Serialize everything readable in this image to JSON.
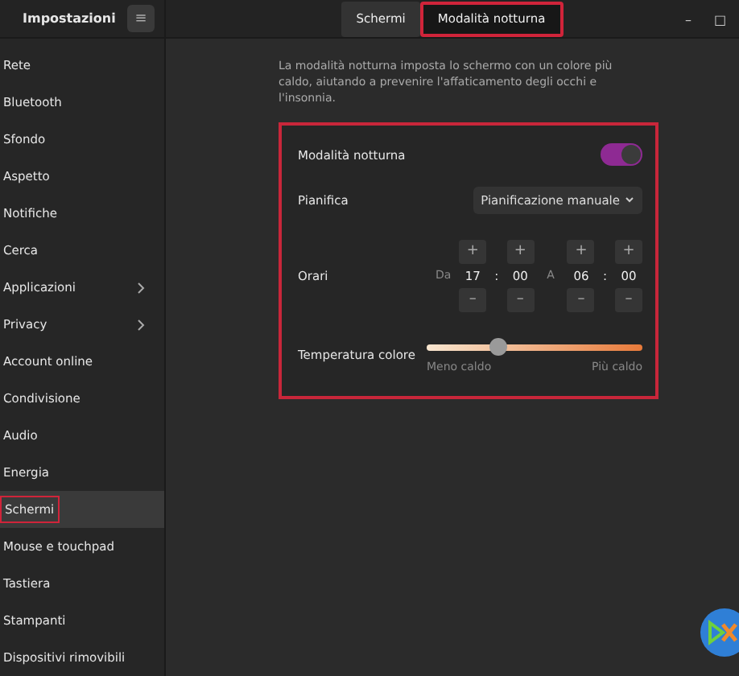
{
  "window": {
    "title": "Impostazioni",
    "menu_button": "≡",
    "controls": [
      "–",
      "□"
    ]
  },
  "tabs": [
    {
      "label": "Schermi",
      "selected": false
    },
    {
      "label": "Modalità notturna",
      "selected": true
    }
  ],
  "sidebar": {
    "items": [
      {
        "label": "Rete",
        "selected": false,
        "has_submenu": false
      },
      {
        "label": "Bluetooth",
        "selected": false,
        "has_submenu": false
      },
      {
        "label": "Sfondo",
        "selected": false,
        "has_submenu": false
      },
      {
        "label": "Aspetto",
        "selected": false,
        "has_submenu": false
      },
      {
        "label": "Notifiche",
        "selected": false,
        "has_submenu": false
      },
      {
        "label": "Cerca",
        "selected": false,
        "has_submenu": false
      },
      {
        "label": "Applicazioni",
        "selected": false,
        "has_submenu": true
      },
      {
        "label": "Privacy",
        "selected": false,
        "has_submenu": true
      },
      {
        "label": "Account online",
        "selected": false,
        "has_submenu": false
      },
      {
        "label": "Condivisione",
        "selected": false,
        "has_submenu": false
      },
      {
        "label": "Audio",
        "selected": false,
        "has_submenu": false
      },
      {
        "label": "Energia",
        "selected": false,
        "has_submenu": false
      },
      {
        "label": "Schermi",
        "selected": true,
        "has_submenu": false
      },
      {
        "label": "Mouse e touchpad",
        "selected": false,
        "has_submenu": false
      },
      {
        "label": "Tastiera",
        "selected": false,
        "has_submenu": false
      },
      {
        "label": "Stampanti",
        "selected": false,
        "has_submenu": false
      },
      {
        "label": "Dispositivi rimovibili",
        "selected": false,
        "has_submenu": false
      }
    ]
  },
  "description": "La modalità notturna imposta lo schermo con un colore più caldo, aiutando a prevenire l'affaticamento degli occhi e l'insonnia.",
  "night_mode": {
    "label": "Modalità notturna",
    "on": true
  },
  "schedule": {
    "label": "Pianifica",
    "value": "Pianificazione manuale"
  },
  "times": {
    "label": "Orari",
    "plus": "+",
    "minus": "–",
    "separator": ":",
    "from": {
      "label": "Da",
      "hours": "17",
      "minutes": "00"
    },
    "to": {
      "label": "A",
      "hours": "06",
      "minutes": "00"
    }
  },
  "temperature": {
    "label": "Temperatura colore",
    "level": 0.33,
    "min_label": "Meno caldo",
    "max_label": "Più caldo"
  }
}
